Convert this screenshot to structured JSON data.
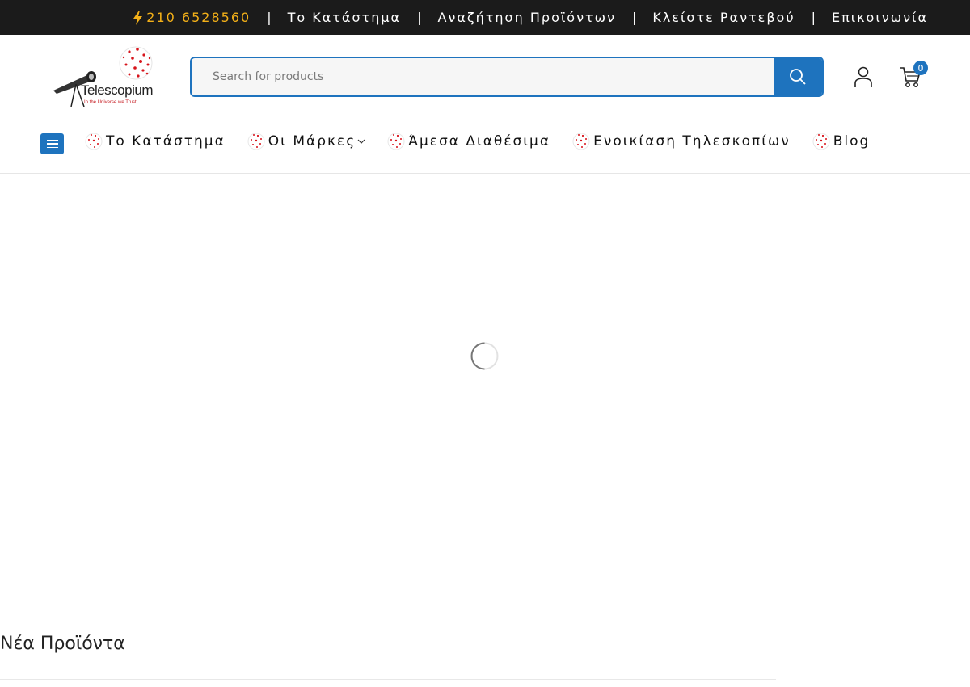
{
  "topbar": {
    "phone": "210 6528560",
    "separator": "|",
    "links": [
      "Το Κατάστημα",
      "Αναζήτηση Προϊόντων",
      "Κλείστε Ραντεβού",
      "Επικοινωνία"
    ],
    "phone_color": "#f3b018"
  },
  "header": {
    "logo_text": "Telescopium",
    "logo_tagline": "In the Universe we Trust",
    "search": {
      "placeholder": "Search for products"
    },
    "cart_count": "0",
    "accent_color": "#1e73be"
  },
  "nav": {
    "items": [
      {
        "label": "Το Κατάστημα",
        "has_dropdown": false
      },
      {
        "label": "Οι Μάρκες",
        "has_dropdown": true
      },
      {
        "label": "Άμεσα Διαθέσιμα",
        "has_dropdown": false
      },
      {
        "label": "Ενοικίαση Τηλεσκοπίων",
        "has_dropdown": false
      },
      {
        "label": "Blog",
        "has_dropdown": false
      }
    ]
  },
  "main": {
    "section_title": "Νέα Προϊόντα"
  }
}
